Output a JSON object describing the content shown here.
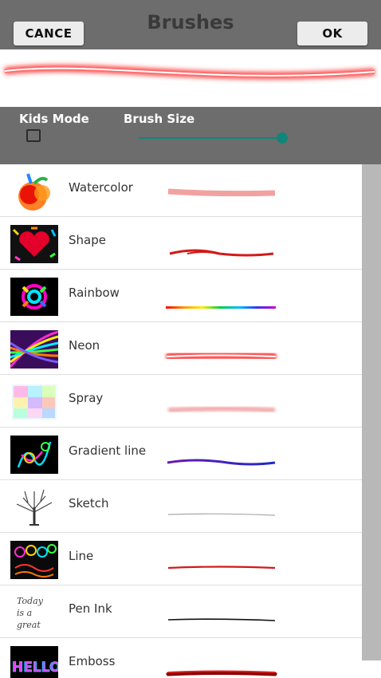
{
  "header": {
    "title": "Brushes",
    "cancel_label": "CANCE",
    "ok_label": "OK"
  },
  "settings": {
    "kids_mode_label": "Kids Mode",
    "kids_mode_checked": false,
    "brush_size_label": "Brush Size",
    "brush_size_level": 0.97
  },
  "brushes": [
    {
      "name": "Watercolor",
      "thumb_icon": "apple-painting-icon"
    },
    {
      "name": "Shape",
      "thumb_icon": "heart-pattern-icon"
    },
    {
      "name": "Rainbow",
      "thumb_icon": "rainbow-flower-icon"
    },
    {
      "name": "Neon",
      "thumb_icon": "neon-lines-icon"
    },
    {
      "name": "Spray",
      "thumb_icon": "spray-grid-icon"
    },
    {
      "name": "Gradient line",
      "thumb_icon": "gradient-doodle-icon"
    },
    {
      "name": "Sketch",
      "thumb_icon": "tree-sketch-icon"
    },
    {
      "name": "Line",
      "thumb_icon": "line-doodle-icon"
    },
    {
      "name": "Pen Ink",
      "thumb_icon": "handwriting-icon",
      "thumb_text": [
        "Today",
        "is a",
        "great"
      ]
    },
    {
      "name": "Emboss",
      "thumb_icon": "hello-emboss-icon",
      "thumb_text": [
        "HELLO"
      ]
    }
  ],
  "colors": {
    "header": "#6d6d6d",
    "accent": "#12857a",
    "neon_glow": "#ff3b3b"
  }
}
